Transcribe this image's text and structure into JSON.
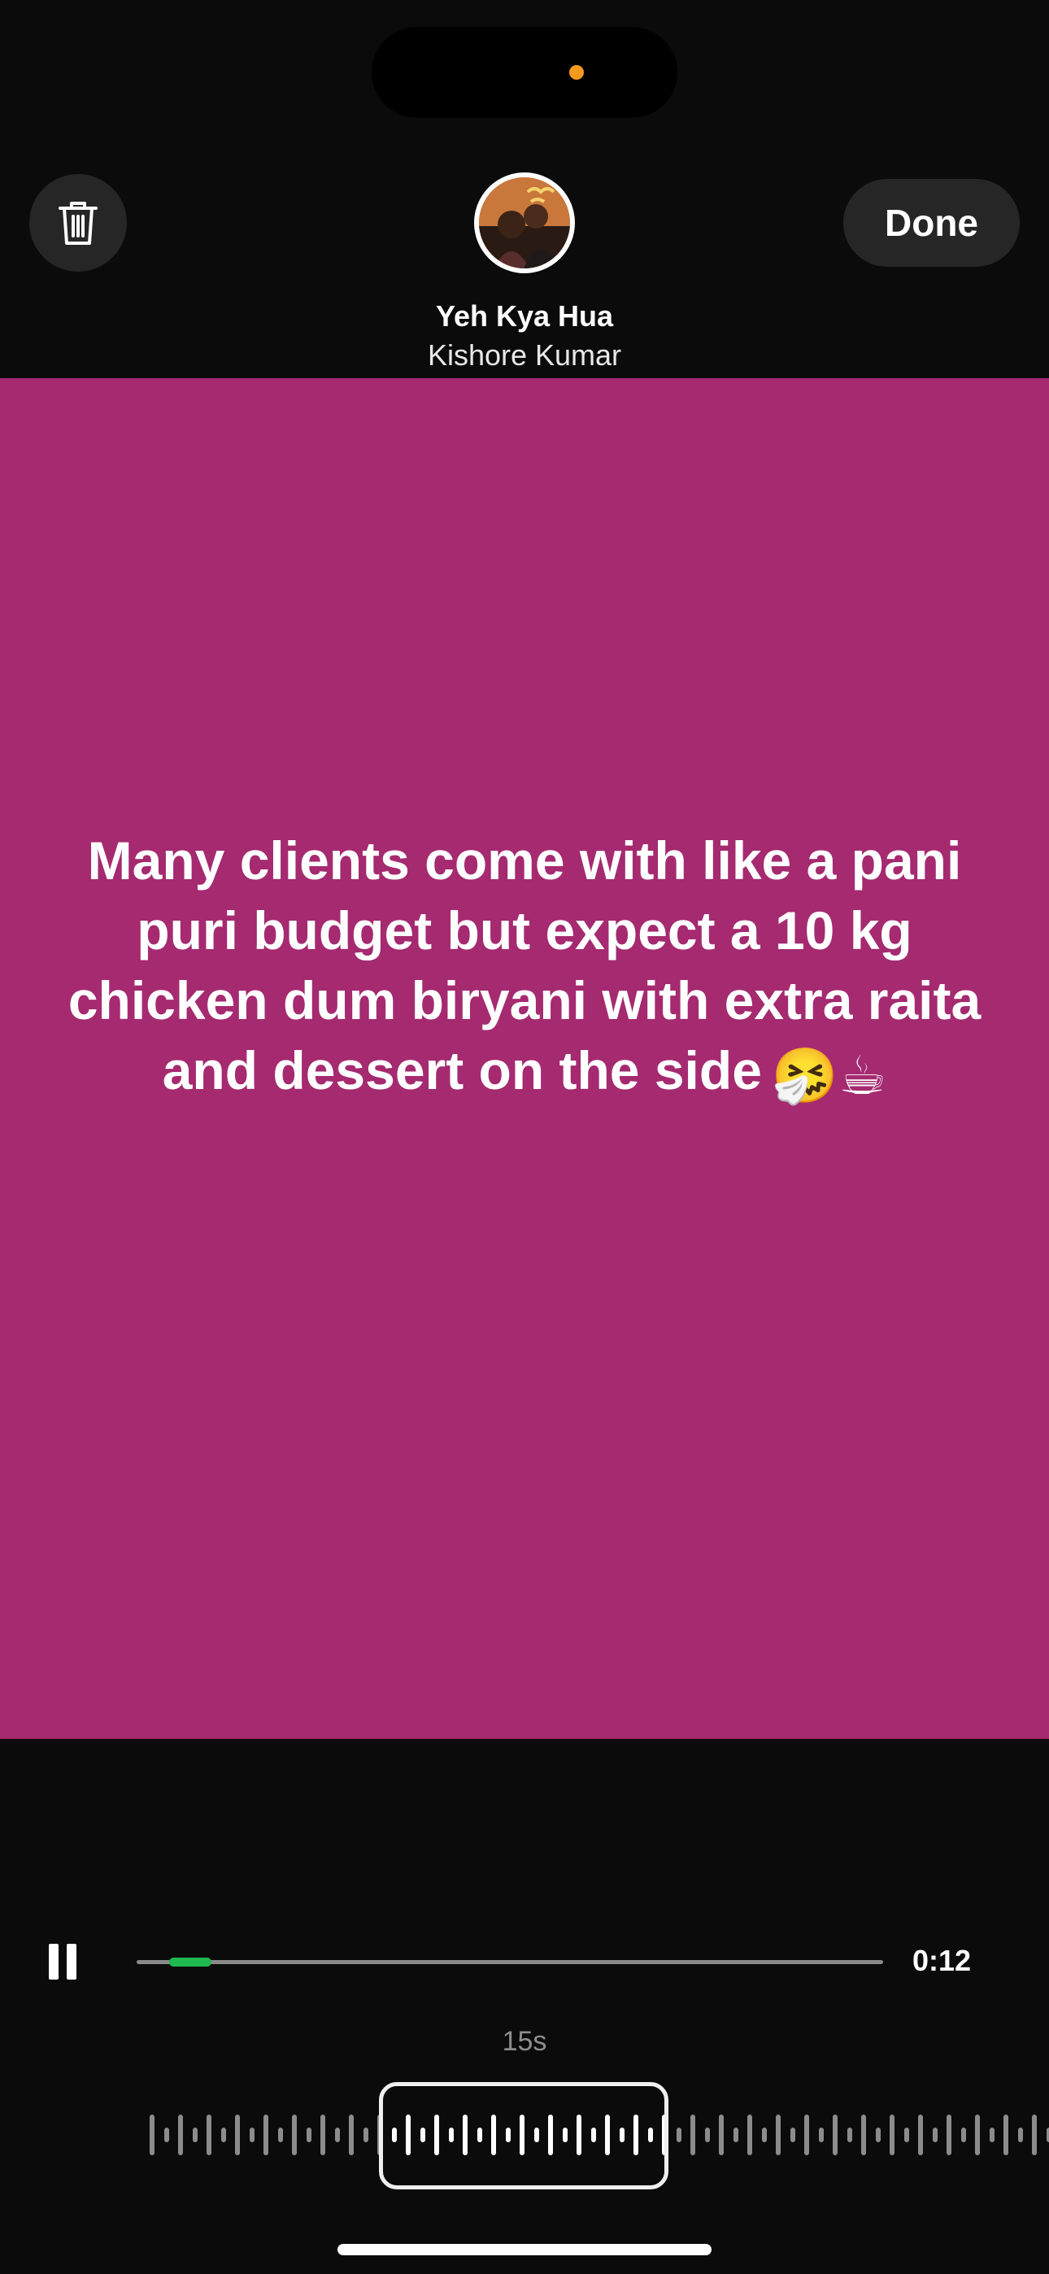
{
  "header": {
    "done_label": "Done",
    "song_title": "Yeh Kya Hua",
    "song_artist": "Kishore Kumar",
    "icons": {
      "trash": "trash-icon",
      "album": "album-art"
    }
  },
  "story": {
    "background_color": "#a52a70",
    "text": "Many  clients come with like a pani\npuri budget but expect a 10 kg\nchicken dum biryani with extra raita\nand dessert on the side",
    "emoji": "🤧☕"
  },
  "playback": {
    "state_icon": "pause-icon",
    "elapsed": "0:12",
    "clip_length_label": "15s",
    "progress_fraction": 0.05,
    "accent_color": "#1fb84f"
  }
}
